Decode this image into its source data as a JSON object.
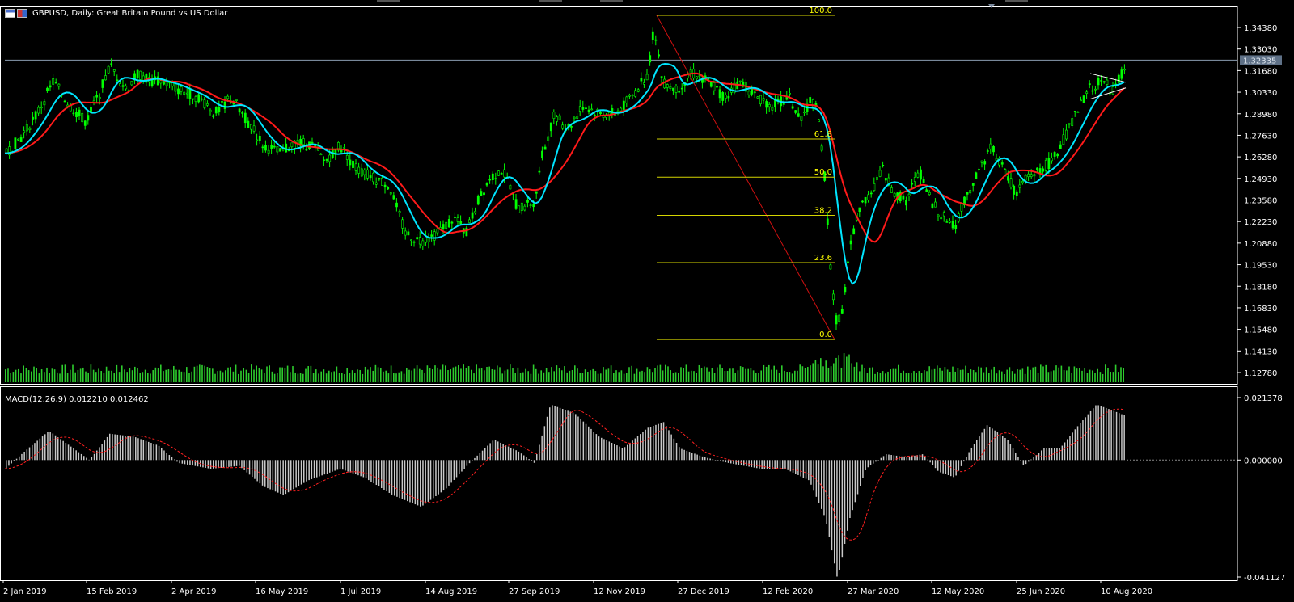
{
  "window": {
    "symbol": "GBPUSD",
    "timeframe": "Daily",
    "description": "Great Britain Pound vs US Dollar",
    "title": "GBPUSD, Daily:  Great Britain Pound vs US Dollar"
  },
  "colors": {
    "background": "#000000",
    "candle_bull": "#00ff00",
    "candle_bear": "#00ff00",
    "ma_fast": "#00e5ff",
    "ma_slow": "#ff1a1a",
    "fib": "#d4d400",
    "fib_text": "#ffff00",
    "volume": "#2ecc2e",
    "macd_hist": "#c8c8c8",
    "macd_signal": "#ff2020",
    "grid_text": "#ffffff",
    "bid_line": "#8a9bb0",
    "bid_label_bg": "#5f7187",
    "frame": "#ffffff"
  },
  "icons": [
    "chart-window-icon",
    "flag-icon"
  ],
  "price_axis": {
    "labels": [
      "1.34380",
      "1.33030",
      "1.31680",
      "1.30330",
      "1.28980",
      "1.27630",
      "1.26280",
      "1.24930",
      "1.23580",
      "1.22230",
      "1.20880",
      "1.19530",
      "1.18180",
      "1.16830",
      "1.15480",
      "1.14130",
      "1.12780"
    ],
    "current_price": "1.32335"
  },
  "time_axis": {
    "labels": [
      "2 Jan 2019",
      "15 Feb 2019",
      "2 Apr 2019",
      "16 May 2019",
      "1 Jul 2019",
      "14 Aug 2019",
      "27 Sep 2019",
      "12 Nov 2019",
      "27 Dec 2019",
      "12 Feb 2020",
      "27 Mar 2020",
      "12 May 2020",
      "25 Jun 2020",
      "10 Aug 2020"
    ]
  },
  "fibonacci": {
    "levels": [
      {
        "label": "100.0",
        "price": 1.3514
      },
      {
        "label": "61.8",
        "price": 1.274
      },
      {
        "label": "50.0",
        "price": 1.2501
      },
      {
        "label": "38.2",
        "price": 1.2262
      },
      {
        "label": "23.6",
        "price": 1.1966
      },
      {
        "label": "0.0",
        "price": 1.1485
      }
    ]
  },
  "macd": {
    "title": "MACD(12,26,9) 0.012210 0.012462",
    "axis_labels": [
      "0.021378",
      "0.000000",
      "-0.041127"
    ]
  },
  "chart_data": {
    "type": "candlestick",
    "title": "GBPUSD, Daily:  Great Britain Pound vs US Dollar",
    "x": [
      "2 Jan 2019",
      "15 Feb 2019",
      "2 Apr 2019",
      "16 May 2019",
      "1 Jul 2019",
      "14 Aug 2019",
      "27 Sep 2019",
      "12 Nov 2019",
      "27 Dec 2019",
      "12 Feb 2020",
      "27 Mar 2020",
      "12 May 2020",
      "25 Jun 2020",
      "10 Aug 2020"
    ],
    "close_approx": [
      1.27,
      1.295,
      1.31,
      1.28,
      1.265,
      1.205,
      1.23,
      1.285,
      1.305,
      1.3,
      1.23,
      1.23,
      1.255,
      1.318
    ],
    "ylim": [
      1.127,
      1.348
    ],
    "current_price": 1.32335,
    "macd_ylim": [
      -0.041127,
      0.021378
    ],
    "macd_hist_approx": [
      -0.002,
      0.01,
      0.004,
      -0.004,
      -0.009,
      -0.012,
      0.003,
      0.01,
      0.005,
      -0.002,
      -0.037,
      0.001,
      -0.001,
      0.012
    ],
    "grid": false,
    "legend": "none"
  }
}
